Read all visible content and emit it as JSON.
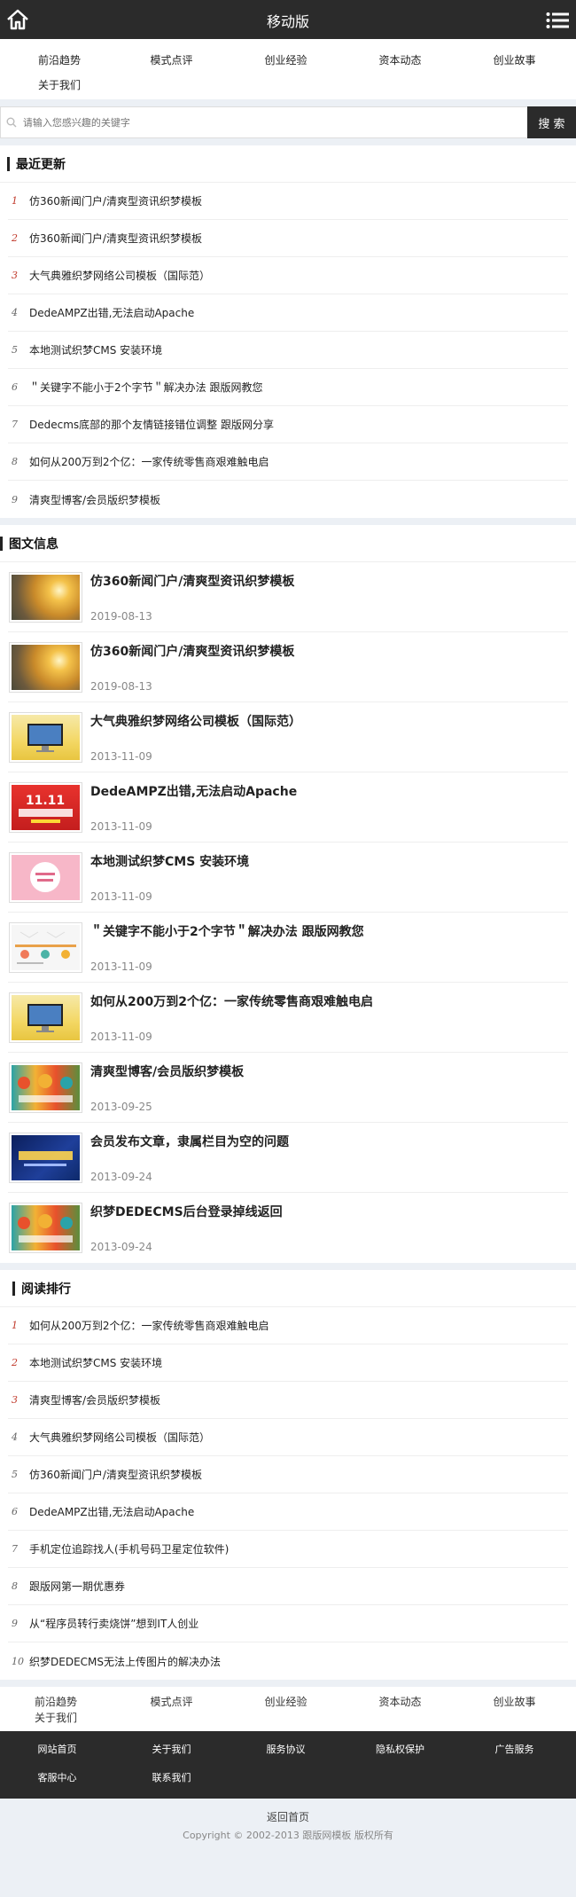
{
  "header": {
    "title": "移动版",
    "home_icon": "home-icon",
    "menu_icon": "menu-icon"
  },
  "nav": [
    "前沿趋势",
    "模式点评",
    "创业经验",
    "资本动态",
    "创业故事",
    "关于我们"
  ],
  "search": {
    "placeholder": "请输入您感兴趣的关键字",
    "button": "搜 索"
  },
  "latest": {
    "title": "最近更新",
    "items": [
      "仿360新闻门户/清爽型资讯织梦模板",
      "仿360新闻门户/清爽型资讯织梦模板",
      "大气典雅织梦网络公司模板（国际范）",
      "DedeAMPZ出错,无法启动Apache",
      "本地测试织梦CMS 安装环境",
      "＂关键字不能小于2个字节＂解决办法 跟版网教您",
      "Dedecms底部的那个友情链接错位调整 跟版网分享",
      "如何从200万到2个亿：一家传统零售商艰难触电启",
      "清爽型博客/会员版织梦模板"
    ],
    "numbers": [
      "1",
      "2",
      "3",
      "4",
      "5",
      "6",
      "7",
      "8",
      "9"
    ]
  },
  "pics": {
    "title": "图文信息",
    "items": [
      {
        "title": "仿360新闻门户/清爽型资讯织梦模板",
        "date": "2019-08-13",
        "thumb": "sunset"
      },
      {
        "title": "仿360新闻门户/清爽型资讯织梦模板",
        "date": "2019-08-13",
        "thumb": "sunset"
      },
      {
        "title": "大气典雅织梦网络公司模板（国际范）",
        "date": "2013-11-09",
        "thumb": "monitor-yellow"
      },
      {
        "title": "DedeAMPZ出错,无法启动Apache",
        "date": "2013-11-09",
        "thumb": "red-banner"
      },
      {
        "title": "本地测试织梦CMS 安装环境",
        "date": "2013-11-09",
        "thumb": "pink-card"
      },
      {
        "title": "＂关键字不能小于2个字节＂解决办法 跟版网教您",
        "date": "2013-11-09",
        "thumb": "infographic"
      },
      {
        "title": "如何从200万到2个亿：一家传统零售商艰难触电启",
        "date": "2013-11-09",
        "thumb": "monitor-yellow"
      },
      {
        "title": "清爽型博客/会员版织梦模板",
        "date": "2013-09-25",
        "thumb": "colorful-icons"
      },
      {
        "title": "会员发布文章，隶属栏目为空的问题",
        "date": "2013-09-24",
        "thumb": "blue-design"
      },
      {
        "title": "织梦DEDECMS后台登录掉线返回",
        "date": "2013-09-24",
        "thumb": "colorful-icons"
      }
    ]
  },
  "ranking": {
    "title": "阅读排行",
    "items": [
      "如何从200万到2个亿：一家传统零售商艰难触电启",
      "本地测试织梦CMS 安装环境",
      "清爽型博客/会员版织梦模板",
      "大气典雅织梦网络公司模板（国际范）",
      "仿360新闻门户/清爽型资讯织梦模板",
      "DedeAMPZ出错,无法启动Apache",
      "手机定位追踪找人(手机号码卫星定位软件)",
      "跟版网第一期优惠券",
      "从“程序员转行卖烧饼”想到IT人创业",
      "织梦DEDECMS无法上传图片的解决办法"
    ],
    "numbers": [
      "1",
      "2",
      "3",
      "4",
      "5",
      "6",
      "7",
      "8",
      "9",
      "10"
    ]
  },
  "bottom_nav": [
    "前沿趋势",
    "模式点评",
    "创业经验",
    "资本动态",
    "创业故事",
    "关于我们"
  ],
  "footer_links": [
    "网站首页",
    "关于我们",
    "服务协议",
    "隐私权保护",
    "广告服务",
    "客服中心",
    "联系我们"
  ],
  "footer": {
    "back": "返回首页",
    "copyright": "Copyright © 2002-2013 跟版网模板 版权所有"
  },
  "colors": {
    "topbar": "#2b2b2b",
    "hot_number": "#c0392b",
    "background": "#ecf0f5"
  }
}
